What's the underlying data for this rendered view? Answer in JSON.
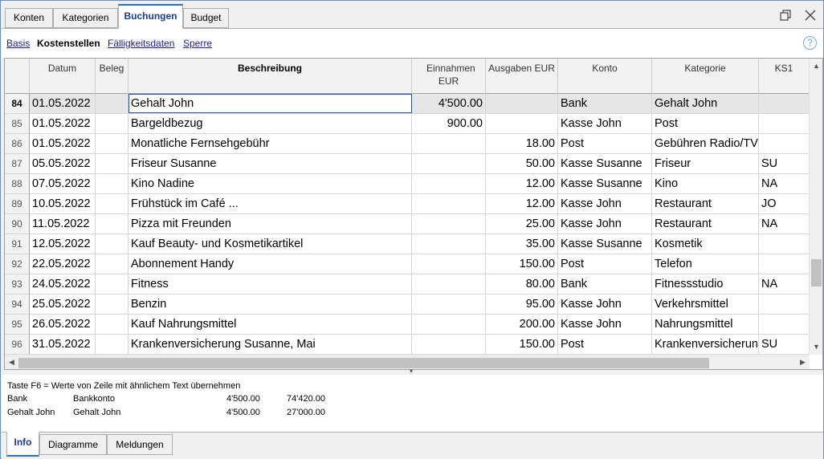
{
  "tabs": [
    {
      "label": "Konten"
    },
    {
      "label": "Kategorien"
    },
    {
      "label": "Buchungen"
    },
    {
      "label": "Budget"
    }
  ],
  "subnav": [
    "Basis",
    "Kostenstellen",
    "Fälligkeitsdaten",
    "Sperre"
  ],
  "help_label": "?",
  "columns": {
    "datum": "Datum",
    "beleg": "Beleg",
    "beschreibung": "Beschreibung",
    "einnahmen": "Einnahmen EUR",
    "ausgaben": "Ausgaben EUR",
    "konto": "Konto",
    "kategorie": "Kategorie",
    "ks1": "KS1"
  },
  "rows": [
    {
      "num": "84",
      "datum": "01.05.2022",
      "beleg": "",
      "beschreibung": "Gehalt John",
      "einnahmen": "4'500.00",
      "ausgaben": "",
      "konto": "Bank",
      "kategorie": "Gehalt John",
      "ks1": ""
    },
    {
      "num": "85",
      "datum": "01.05.2022",
      "beleg": "",
      "beschreibung": "Bargeldbezug",
      "einnahmen": "900.00",
      "ausgaben": "",
      "konto": "Kasse John",
      "kategorie": "Post",
      "ks1": ""
    },
    {
      "num": "86",
      "datum": "01.05.2022",
      "beleg": "",
      "beschreibung": "Monatliche Fernsehgebühr",
      "einnahmen": "",
      "ausgaben": "18.00",
      "konto": "Post",
      "kategorie": "Gebühren Radio/TV",
      "ks1": ""
    },
    {
      "num": "87",
      "datum": "05.05.2022",
      "beleg": "",
      "beschreibung": "Friseur Susanne",
      "einnahmen": "",
      "ausgaben": "50.00",
      "konto": "Kasse Susanne",
      "kategorie": "Friseur",
      "ks1": "SU"
    },
    {
      "num": "88",
      "datum": "07.05.2022",
      "beleg": "",
      "beschreibung": "Kino Nadine",
      "einnahmen": "",
      "ausgaben": "12.00",
      "konto": "Kasse Susanne",
      "kategorie": "Kino",
      "ks1": "NA"
    },
    {
      "num": "89",
      "datum": "10.05.2022",
      "beleg": "",
      "beschreibung": "Frühstück im Café ...",
      "einnahmen": "",
      "ausgaben": "12.00",
      "konto": "Kasse John",
      "kategorie": "Restaurant",
      "ks1": "JO"
    },
    {
      "num": "90",
      "datum": "11.05.2022",
      "beleg": "",
      "beschreibung": "Pizza mit Freunden",
      "einnahmen": "",
      "ausgaben": "25.00",
      "konto": "Kasse John",
      "kategorie": "Restaurant",
      "ks1": "NA"
    },
    {
      "num": "91",
      "datum": "12.05.2022",
      "beleg": "",
      "beschreibung": "Kauf Beauty- und Kosmetikartikel",
      "einnahmen": "",
      "ausgaben": "35.00",
      "konto": "Kasse Susanne",
      "kategorie": "Kosmetik",
      "ks1": ""
    },
    {
      "num": "92",
      "datum": "22.05.2022",
      "beleg": "",
      "beschreibung": "Abonnement Handy",
      "einnahmen": "",
      "ausgaben": "150.00",
      "konto": "Post",
      "kategorie": "Telefon",
      "ks1": ""
    },
    {
      "num": "93",
      "datum": "24.05.2022",
      "beleg": "",
      "beschreibung": "Fitness",
      "einnahmen": "",
      "ausgaben": "80.00",
      "konto": "Bank",
      "kategorie": "Fitnessstudio",
      "ks1": "NA"
    },
    {
      "num": "94",
      "datum": "25.05.2022",
      "beleg": "",
      "beschreibung": "Benzin",
      "einnahmen": "",
      "ausgaben": "95.00",
      "konto": "Kasse John",
      "kategorie": "Verkehrsmittel",
      "ks1": ""
    },
    {
      "num": "95",
      "datum": "26.05.2022",
      "beleg": "",
      "beschreibung": "Kauf Nahrungsmittel",
      "einnahmen": "",
      "ausgaben": "200.00",
      "konto": "Kasse John",
      "kategorie": "Nahrungsmittel",
      "ks1": ""
    },
    {
      "num": "96",
      "datum": "31.05.2022",
      "beleg": "",
      "beschreibung": "Krankenversicherung Susanne, Mai",
      "einnahmen": "",
      "ausgaben": "150.00",
      "konto": "Post",
      "kategorie": "Krankenversicherun",
      "ks1": "SU"
    }
  ],
  "info": {
    "hint": "Taste F6 = Werte von Zeile mit ähnlichem Text übernehmen",
    "lines": [
      {
        "account": "Bank",
        "name": "Bankkonto",
        "amount": "4'500.00",
        "balance": "74'420.00"
      },
      {
        "account": "Gehalt John",
        "name": "Gehalt John",
        "amount": "4'500.00",
        "balance": "27'000.00"
      }
    ]
  },
  "bottom_tabs": [
    {
      "label": "Info"
    },
    {
      "label": "Diagramme"
    },
    {
      "label": "Meldungen"
    }
  ],
  "colors": {
    "accent": "#2a6fd6",
    "current_row": "#e6e6e6"
  },
  "icons": [
    "restore-window-icon",
    "close-icon",
    "help-icon",
    "scroll-up-icon",
    "scroll-down-icon",
    "scroll-left-icon",
    "scroll-right-icon",
    "splitter-arrow-icon"
  ]
}
